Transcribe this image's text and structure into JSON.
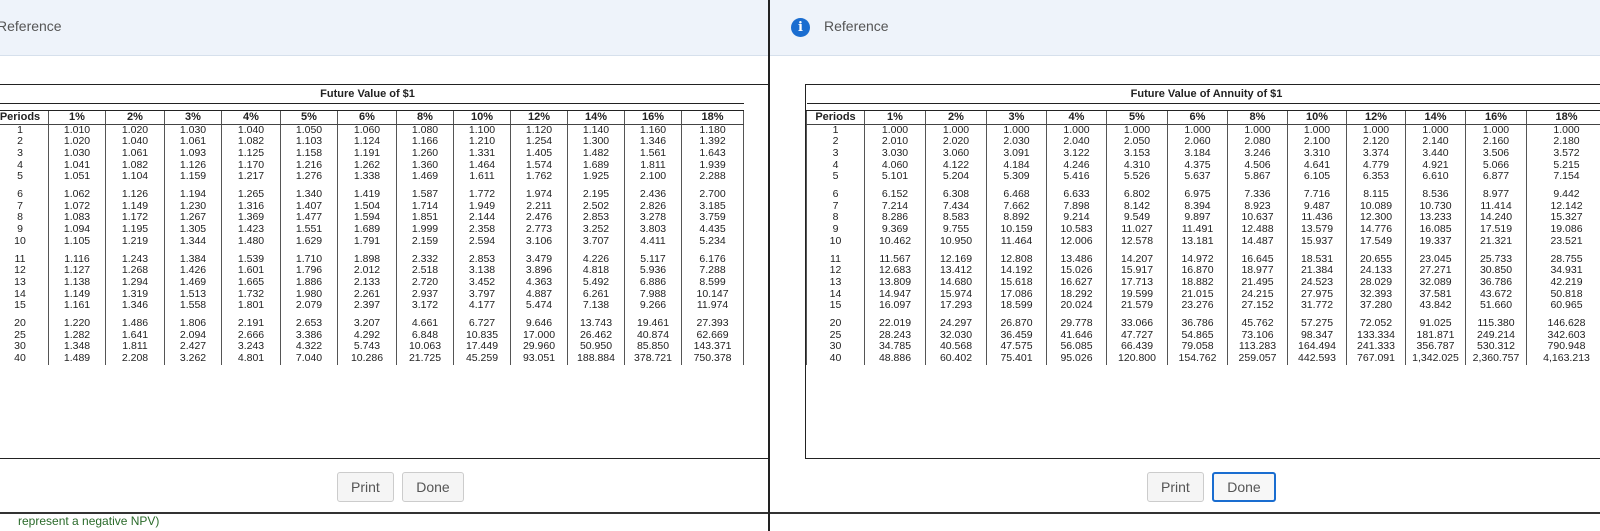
{
  "left": {
    "header_title": "Reference",
    "table_title": "Future Value of $1",
    "headers": [
      "Periods",
      "1%",
      "2%",
      "3%",
      "4%",
      "5%",
      "6%",
      "8%",
      "10%",
      "12%",
      "14%",
      "16%",
      "18%"
    ],
    "groups": [
      [
        [
          "1",
          "1.010",
          "1.020",
          "1.030",
          "1.040",
          "1.050",
          "1.060",
          "1.080",
          "1.100",
          "1.120",
          "1.140",
          "1.160",
          "1.180"
        ],
        [
          "2",
          "1.020",
          "1.040",
          "1.061",
          "1.082",
          "1.103",
          "1.124",
          "1.166",
          "1.210",
          "1.254",
          "1.300",
          "1.346",
          "1.392"
        ],
        [
          "3",
          "1.030",
          "1.061",
          "1.093",
          "1.125",
          "1.158",
          "1.191",
          "1.260",
          "1.331",
          "1.405",
          "1.482",
          "1.561",
          "1.643"
        ],
        [
          "4",
          "1.041",
          "1.082",
          "1.126",
          "1.170",
          "1.216",
          "1.262",
          "1.360",
          "1.464",
          "1.574",
          "1.689",
          "1.811",
          "1.939"
        ],
        [
          "5",
          "1.051",
          "1.104",
          "1.159",
          "1.217",
          "1.276",
          "1.338",
          "1.469",
          "1.611",
          "1.762",
          "1.925",
          "2.100",
          "2.288"
        ]
      ],
      [
        [
          "6",
          "1.062",
          "1.126",
          "1.194",
          "1.265",
          "1.340",
          "1.419",
          "1.587",
          "1.772",
          "1.974",
          "2.195",
          "2.436",
          "2.700"
        ],
        [
          "7",
          "1.072",
          "1.149",
          "1.230",
          "1.316",
          "1.407",
          "1.504",
          "1.714",
          "1.949",
          "2.211",
          "2.502",
          "2.826",
          "3.185"
        ],
        [
          "8",
          "1.083",
          "1.172",
          "1.267",
          "1.369",
          "1.477",
          "1.594",
          "1.851",
          "2.144",
          "2.476",
          "2.853",
          "3.278",
          "3.759"
        ],
        [
          "9",
          "1.094",
          "1.195",
          "1.305",
          "1.423",
          "1.551",
          "1.689",
          "1.999",
          "2.358",
          "2.773",
          "3.252",
          "3.803",
          "4.435"
        ],
        [
          "10",
          "1.105",
          "1.219",
          "1.344",
          "1.480",
          "1.629",
          "1.791",
          "2.159",
          "2.594",
          "3.106",
          "3.707",
          "4.411",
          "5.234"
        ]
      ],
      [
        [
          "11",
          "1.116",
          "1.243",
          "1.384",
          "1.539",
          "1.710",
          "1.898",
          "2.332",
          "2.853",
          "3.479",
          "4.226",
          "5.117",
          "6.176"
        ],
        [
          "12",
          "1.127",
          "1.268",
          "1.426",
          "1.601",
          "1.796",
          "2.012",
          "2.518",
          "3.138",
          "3.896",
          "4.818",
          "5.936",
          "7.288"
        ],
        [
          "13",
          "1.138",
          "1.294",
          "1.469",
          "1.665",
          "1.886",
          "2.133",
          "2.720",
          "3.452",
          "4.363",
          "5.492",
          "6.886",
          "8.599"
        ],
        [
          "14",
          "1.149",
          "1.319",
          "1.513",
          "1.732",
          "1.980",
          "2.261",
          "2.937",
          "3.797",
          "4.887",
          "6.261",
          "7.988",
          "10.147"
        ],
        [
          "15",
          "1.161",
          "1.346",
          "1.558",
          "1.801",
          "2.079",
          "2.397",
          "3.172",
          "4.177",
          "5.474",
          "7.138",
          "9.266",
          "11.974"
        ]
      ],
      [
        [
          "20",
          "1.220",
          "1.486",
          "1.806",
          "2.191",
          "2.653",
          "3.207",
          "4.661",
          "6.727",
          "9.646",
          "13.743",
          "19.461",
          "27.393"
        ],
        [
          "25",
          "1.282",
          "1.641",
          "2.094",
          "2.666",
          "3.386",
          "4.292",
          "6.848",
          "10.835",
          "17.000",
          "26.462",
          "40.874",
          "62.669"
        ],
        [
          "30",
          "1.348",
          "1.811",
          "2.427",
          "3.243",
          "4.322",
          "5.743",
          "10.063",
          "17.449",
          "29.960",
          "50.950",
          "85.850",
          "143.371"
        ],
        [
          "40",
          "1.489",
          "2.208",
          "3.262",
          "4.801",
          "7.040",
          "10.286",
          "21.725",
          "45.259",
          "93.051",
          "188.884",
          "378.721",
          "750.378"
        ]
      ]
    ],
    "print_label": "Print",
    "done_label": "Done",
    "peek_text": "represent a negative NPV)"
  },
  "right": {
    "header_title": "Reference",
    "table_title": "Future Value of Annuity of $1",
    "headers": [
      "Periods",
      "1%",
      "2%",
      "3%",
      "4%",
      "5%",
      "6%",
      "8%",
      "10%",
      "12%",
      "14%",
      "16%",
      "18%"
    ],
    "groups": [
      [
        [
          "1",
          "1.000",
          "1.000",
          "1.000",
          "1.000",
          "1.000",
          "1.000",
          "1.000",
          "1.000",
          "1.000",
          "1.000",
          "1.000",
          "1.000"
        ],
        [
          "2",
          "2.010",
          "2.020",
          "2.030",
          "2.040",
          "2.050",
          "2.060",
          "2.080",
          "2.100",
          "2.120",
          "2.140",
          "2.160",
          "2.180"
        ],
        [
          "3",
          "3.030",
          "3.060",
          "3.091",
          "3.122",
          "3.153",
          "3.184",
          "3.246",
          "3.310",
          "3.374",
          "3.440",
          "3.506",
          "3.572"
        ],
        [
          "4",
          "4.060",
          "4.122",
          "4.184",
          "4.246",
          "4.310",
          "4.375",
          "4.506",
          "4.641",
          "4.779",
          "4.921",
          "5.066",
          "5.215"
        ],
        [
          "5",
          "5.101",
          "5.204",
          "5.309",
          "5.416",
          "5.526",
          "5.637",
          "5.867",
          "6.105",
          "6.353",
          "6.610",
          "6.877",
          "7.154"
        ]
      ],
      [
        [
          "6",
          "6.152",
          "6.308",
          "6.468",
          "6.633",
          "6.802",
          "6.975",
          "7.336",
          "7.716",
          "8.115",
          "8.536",
          "8.977",
          "9.442"
        ],
        [
          "7",
          "7.214",
          "7.434",
          "7.662",
          "7.898",
          "8.142",
          "8.394",
          "8.923",
          "9.487",
          "10.089",
          "10.730",
          "11.414",
          "12.142"
        ],
        [
          "8",
          "8.286",
          "8.583",
          "8.892",
          "9.214",
          "9.549",
          "9.897",
          "10.637",
          "11.436",
          "12.300",
          "13.233",
          "14.240",
          "15.327"
        ],
        [
          "9",
          "9.369",
          "9.755",
          "10.159",
          "10.583",
          "11.027",
          "11.491",
          "12.488",
          "13.579",
          "14.776",
          "16.085",
          "17.519",
          "19.086"
        ],
        [
          "10",
          "10.462",
          "10.950",
          "11.464",
          "12.006",
          "12.578",
          "13.181",
          "14.487",
          "15.937",
          "17.549",
          "19.337",
          "21.321",
          "23.521"
        ]
      ],
      [
        [
          "11",
          "11.567",
          "12.169",
          "12.808",
          "13.486",
          "14.207",
          "14.972",
          "16.645",
          "18.531",
          "20.655",
          "23.045",
          "25.733",
          "28.755"
        ],
        [
          "12",
          "12.683",
          "13.412",
          "14.192",
          "15.026",
          "15.917",
          "16.870",
          "18.977",
          "21.384",
          "24.133",
          "27.271",
          "30.850",
          "34.931"
        ],
        [
          "13",
          "13.809",
          "14.680",
          "15.618",
          "16.627",
          "17.713",
          "18.882",
          "21.495",
          "24.523",
          "28.029",
          "32.089",
          "36.786",
          "42.219"
        ],
        [
          "14",
          "14.947",
          "15.974",
          "17.086",
          "18.292",
          "19.599",
          "21.015",
          "24.215",
          "27.975",
          "32.393",
          "37.581",
          "43.672",
          "50.818"
        ],
        [
          "15",
          "16.097",
          "17.293",
          "18.599",
          "20.024",
          "21.579",
          "23.276",
          "27.152",
          "31.772",
          "37.280",
          "43.842",
          "51.660",
          "60.965"
        ]
      ],
      [
        [
          "20",
          "22.019",
          "24.297",
          "26.870",
          "29.778",
          "33.066",
          "36.786",
          "45.762",
          "57.275",
          "72.052",
          "91.025",
          "115.380",
          "146.628"
        ],
        [
          "25",
          "28.243",
          "32.030",
          "36.459",
          "41.646",
          "47.727",
          "54.865",
          "73.106",
          "98.347",
          "133.334",
          "181.871",
          "249.214",
          "342.603"
        ],
        [
          "30",
          "34.785",
          "40.568",
          "47.575",
          "56.085",
          "66.439",
          "79.058",
          "113.283",
          "164.494",
          "241.333",
          "356.787",
          "530.312",
          "790.948"
        ],
        [
          "40",
          "48.886",
          "60.402",
          "75.401",
          "95.026",
          "120.800",
          "154.762",
          "259.057",
          "442.593",
          "767.091",
          "1,342.025",
          "2,360.757",
          "4,163.213"
        ]
      ]
    ],
    "print_label": "Print",
    "done_label": "Done"
  }
}
